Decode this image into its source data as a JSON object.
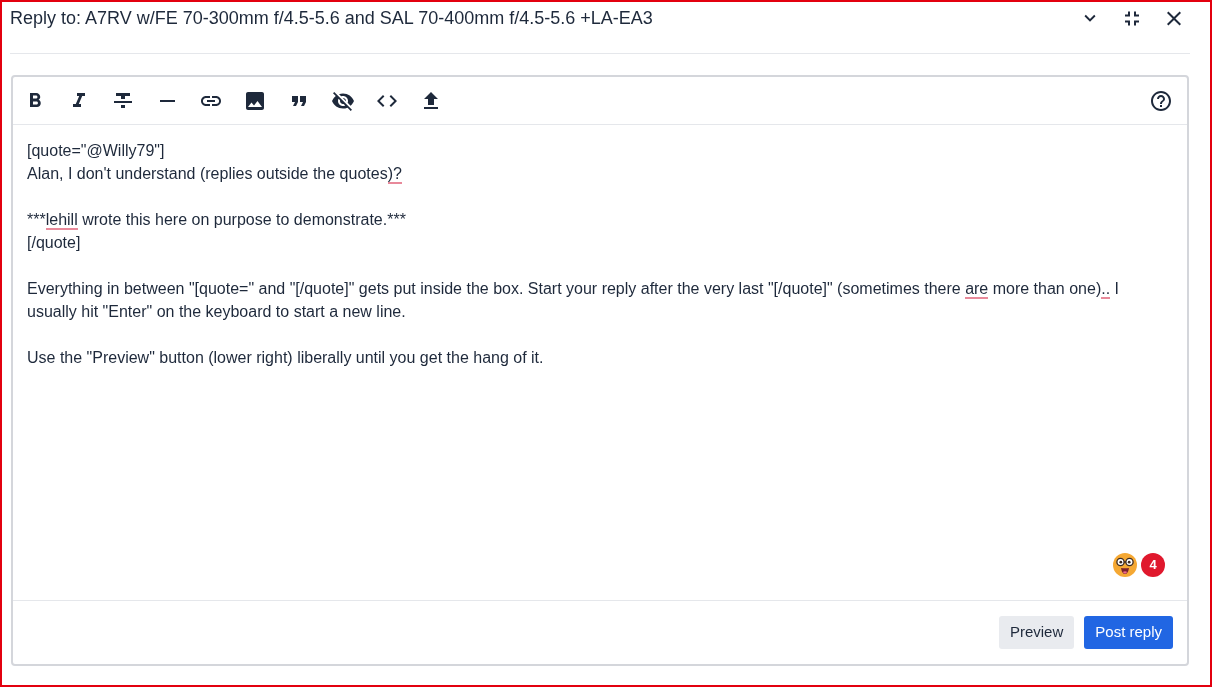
{
  "dialog": {
    "title": "Reply to: A7RV w/FE 70-300mm f/4.5-5.6 and SAL 70-400mm f/4.5-5.6 +LA-EA3"
  },
  "editor": {
    "paragraphs": [
      {
        "lines": [
          [
            {
              "text": "[quote=\"@Willy79\"]",
              "misspelled": false
            }
          ],
          [
            {
              "text": "Alan, I don't understand (replies outside the quotes",
              "misspelled": false
            },
            {
              "text": ")?",
              "misspelled": true
            }
          ]
        ]
      },
      {
        "lines": [
          [
            {
              "text": "***",
              "misspelled": false
            },
            {
              "text": "lehill",
              "misspelled": true
            },
            {
              "text": " wrote this here on purpose to demonstrate.***",
              "misspelled": false
            }
          ],
          [
            {
              "text": "[/quote]",
              "misspelled": false
            }
          ]
        ]
      },
      {
        "lines": [
          [
            {
              "text": "Everything in between \"[quote=\" and \"[/quote]\" gets put inside the box. Start your reply after the very last \"[/quote]\" (sometimes there ",
              "misspelled": false
            },
            {
              "text": "are",
              "misspelled": true
            },
            {
              "text": " more than one)",
              "misspelled": false
            },
            {
              "text": "..",
              "misspelled": true
            },
            {
              "text": " I usually hit \"Enter\" on the keyboard to start a new line.",
              "misspelled": false
            }
          ]
        ]
      },
      {
        "lines": [
          [
            {
              "text": "Use the \"Preview\" button (lower right) liberally until you get the hang of it.",
              "misspelled": false
            }
          ]
        ]
      }
    ],
    "badge": {
      "count": "4"
    }
  },
  "buttons": [
    {
      "label": "Preview",
      "kind": "secondary"
    },
    {
      "label": "Post reply",
      "kind": "primary"
    }
  ]
}
